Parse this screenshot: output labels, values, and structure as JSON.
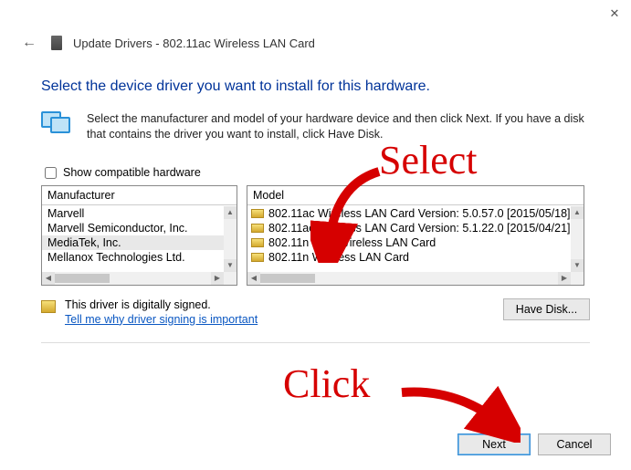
{
  "window": {
    "title": "Update Drivers - 802.11ac Wireless LAN Card"
  },
  "page": {
    "heading": "Select the device driver you want to install for this hardware.",
    "instructions": "Select the manufacturer and model of your hardware device and then click Next. If you have a disk that contains the driver you want to install, click Have Disk."
  },
  "compat_checkbox": {
    "checked": false,
    "label": "Show compatible hardware"
  },
  "manufacturer": {
    "header": "Manufacturer",
    "items": [
      "Marvell",
      "Marvell Semiconductor, Inc.",
      "MediaTek, Inc.",
      "Mellanox Technologies Ltd."
    ],
    "selected_index": 2
  },
  "model": {
    "header": "Model",
    "items": [
      "802.11ac Wireless LAN Card Version: 5.0.57.0 [2015/05/18]",
      "802.11ac Wireless LAN Card Version: 5.1.22.0 [2015/04/21]",
      "802.11n USB Wireless LAN Card",
      "802.11n Wireless LAN Card"
    ],
    "selected_index": 0
  },
  "signed": {
    "text": "This driver is digitally signed.",
    "link": "Tell me why driver signing is important"
  },
  "buttons": {
    "have_disk": "Have Disk...",
    "next": "Next",
    "cancel": "Cancel"
  },
  "annotations": {
    "select": "Select",
    "click": "Click"
  }
}
